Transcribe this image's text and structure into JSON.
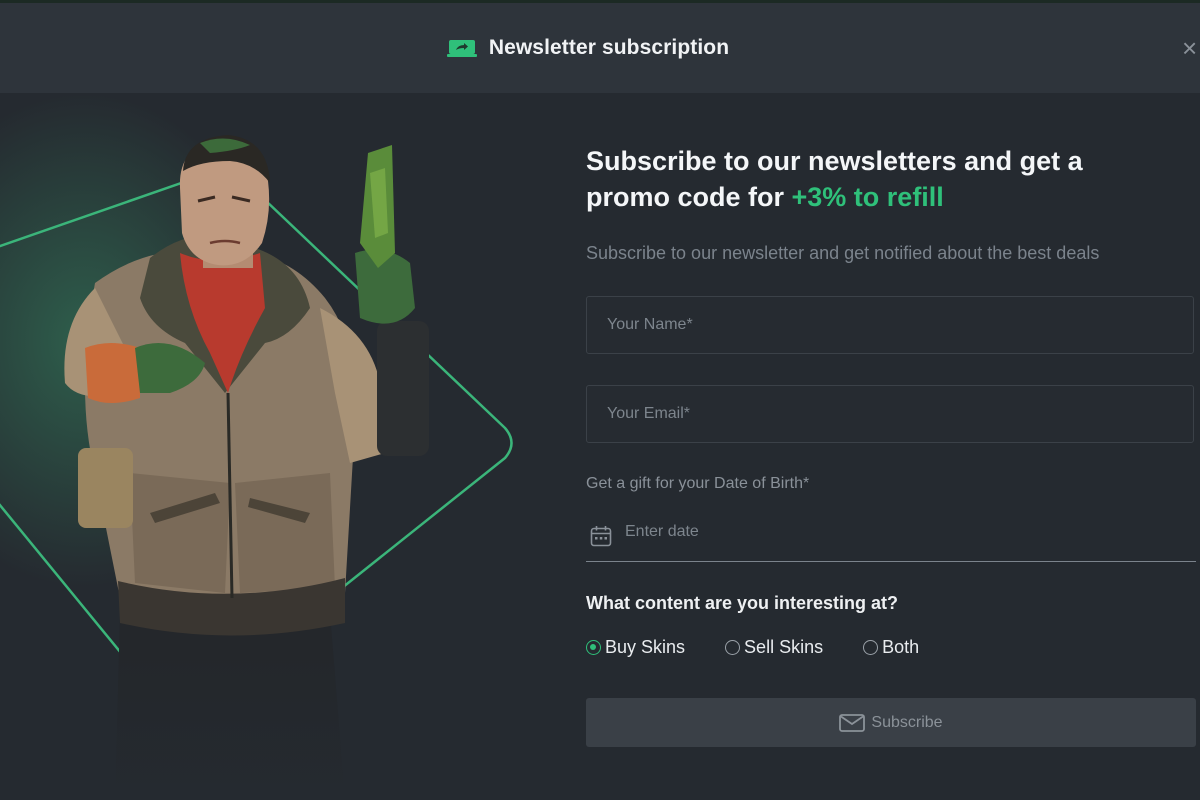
{
  "header": {
    "title": "Newsletter subscription",
    "close": "×"
  },
  "promo": {
    "heading_prefix": "Subscribe to our newsletters and get a promo code for ",
    "heading_accent": "+3% to refill",
    "subtext": "Subscribe to our newsletter and get notified about the best deals"
  },
  "form": {
    "name_placeholder": "Your Name*",
    "email_placeholder": "Your Email*",
    "dob_label": "Get a gift for your Date of Birth*",
    "date_placeholder": "Enter date",
    "question": "What content are you interesting at?",
    "options": [
      {
        "label": "Buy Skins",
        "selected": true
      },
      {
        "label": "Sell Skins",
        "selected": false
      },
      {
        "label": "Both",
        "selected": false
      }
    ],
    "subscribe_label": "Subscribe"
  },
  "icons": {
    "header": "promo-tag-icon",
    "calendar": "calendar-icon",
    "subscribe": "mail-icon"
  },
  "colors": {
    "accent": "#2fc07a",
    "background": "#252a30",
    "header_bg": "#2e343b",
    "button_bg": "#3a4047"
  }
}
